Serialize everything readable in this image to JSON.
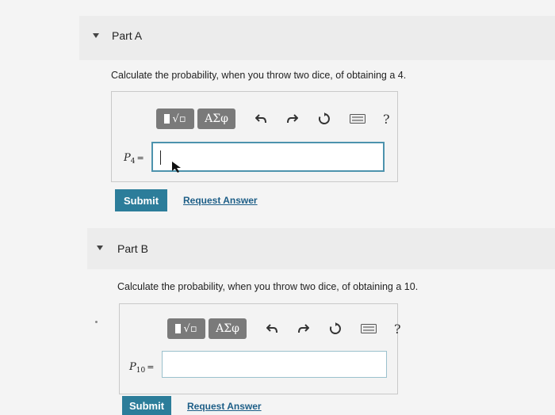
{
  "colors": {
    "accent": "#2c7d9a",
    "link": "#1d5e87",
    "input_border": "#4d93ad",
    "toolbar_button": "#7a7a7a"
  },
  "toolbar": {
    "greek_label": "ΑΣφ",
    "help_label": "?",
    "icons": [
      "template-icon",
      "undo-icon",
      "redo-icon",
      "reset-icon",
      "keyboard-icon",
      "help-icon"
    ]
  },
  "part_a": {
    "title": "Part A",
    "question": "Calculate the probability, when you throw two dice, of obtaining a 4.",
    "var_symbol": "P",
    "var_subscript": "4",
    "var_equals": "=",
    "answer_value": "",
    "submit_label": "Submit",
    "request_label": "Request Answer"
  },
  "part_b": {
    "title": "Part B",
    "question": "Calculate the probability, when you throw two dice, of obtaining a 10.",
    "var_symbol": "P",
    "var_subscript": "10",
    "var_equals": "=",
    "answer_value": "",
    "submit_label": "Submit",
    "request_label": "Request Answer"
  }
}
